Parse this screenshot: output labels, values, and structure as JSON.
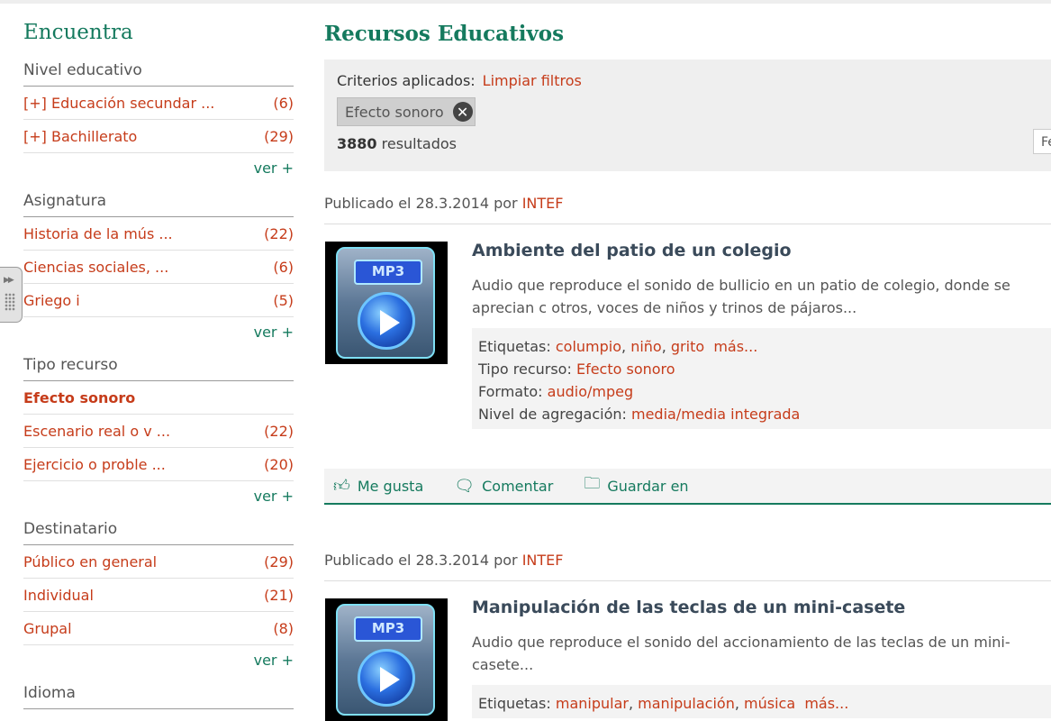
{
  "sidebar": {
    "title": "Encuentra",
    "sections": [
      {
        "title": "Nivel educativo",
        "items": [
          {
            "label": "[+]  Educación secundar ...",
            "count": "(6)"
          },
          {
            "label": "[+]  Bachillerato",
            "count": "(29)"
          }
        ],
        "more": "ver +"
      },
      {
        "title": "Asignatura",
        "items": [
          {
            "label": "Historia de la mús ...",
            "count": "(22)"
          },
          {
            "label": "Ciencias sociales, ...",
            "count": "(6)"
          },
          {
            "label": "Griego i",
            "count": "(5)"
          }
        ],
        "more": "ver +"
      },
      {
        "title": "Tipo recurso",
        "active_item": "Efecto sonoro",
        "items": [
          {
            "label": "Escenario real o v ...",
            "count": "(22)"
          },
          {
            "label": "Ejercicio o proble ...",
            "count": "(20)"
          }
        ],
        "more": "ver +"
      },
      {
        "title": "Destinatario",
        "items": [
          {
            "label": "Público en general",
            "count": "(29)"
          },
          {
            "label": "Individual",
            "count": "(21)"
          },
          {
            "label": "Grupal",
            "count": "(8)"
          }
        ],
        "more": "ver +"
      },
      {
        "title": "Idioma"
      }
    ]
  },
  "main": {
    "title": "Recursos Educativos",
    "criteria": {
      "label": "Criterios aplicados:",
      "clear": "Limpiar filtros",
      "chip": "Efecto sonoro",
      "results_count": "3880",
      "results_label": "resultados",
      "sort_partial": "Fe"
    },
    "results": [
      {
        "published": "Publicado el 28.3.2014 por",
        "author": "INTEF",
        "thumb_text": "MP3",
        "title": "Ambiente del patio de un colegio",
        "description": "Audio que reproduce el sonido de bullicio en un patio de colegio, donde se aprecian c otros, voces de niños y trinos de pájaros...",
        "tags_label": "Etiquetas:",
        "tags": [
          "columpio",
          "niño",
          "grito"
        ],
        "more": "más...",
        "type_label": "Tipo recurso:",
        "type": "Efecto sonoro",
        "format_label": "Formato:",
        "format": "audio/mpeg",
        "aggregation_label": "Nivel de agregación:",
        "aggregation": "media/media integrada"
      },
      {
        "published": "Publicado el 28.3.2014 por",
        "author": "INTEF",
        "thumb_text": "MP3",
        "title": "Manipulación de las teclas de un mini-casete",
        "description": "Audio que reproduce el sonido del accionamiento de las teclas de un mini-casete...",
        "tags_label": "Etiquetas:",
        "tags": [
          "manipular",
          "manipulación",
          "música"
        ],
        "more": "más..."
      }
    ],
    "actions": {
      "like": "Me gusta",
      "comment": "Comentar",
      "save": "Guardar en"
    }
  }
}
